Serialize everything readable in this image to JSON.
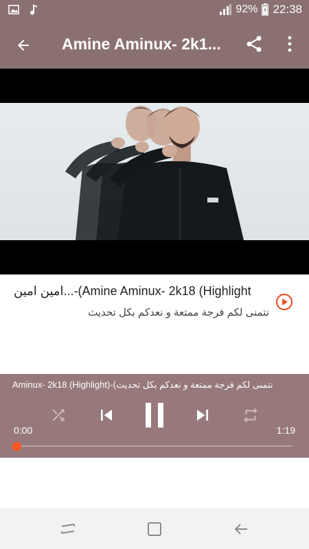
{
  "status_bar": {
    "battery": "92%",
    "time": "22:38",
    "icons": [
      "image-icon",
      "music-note-icon",
      "signal-icon",
      "battery-icon"
    ]
  },
  "app_bar": {
    "title": "Amine Aminux- 2k1...",
    "icons": [
      "back-arrow-icon",
      "share-icon",
      "more-vert-icon"
    ]
  },
  "video_info": {
    "title": "امين امين...-(Amine Aminux- 2k18 (Highlight",
    "subtitle": "نتمنى لكم فرجة ممتعة و نعدكم بكل تحديث",
    "accent_color": "#e8552a"
  },
  "player": {
    "scrolling_title": "Aminux- 2k18 (Highlight)-(نتمنى لكم فرجة ممتعة و نعدكم بكل تحديث",
    "elapsed": "0:00",
    "duration": "1:19",
    "progress": 0.0,
    "progress_color": "#ff5722",
    "controls": [
      "shuffle-icon",
      "skip-previous-icon",
      "pause-icon",
      "skip-next-icon",
      "repeat-icon"
    ]
  },
  "nav_bar": {
    "buttons": [
      "recent-apps-icon",
      "home-icon",
      "back-icon"
    ]
  },
  "colors": {
    "primary": "#8b7072",
    "player_bg": "#97797b"
  }
}
